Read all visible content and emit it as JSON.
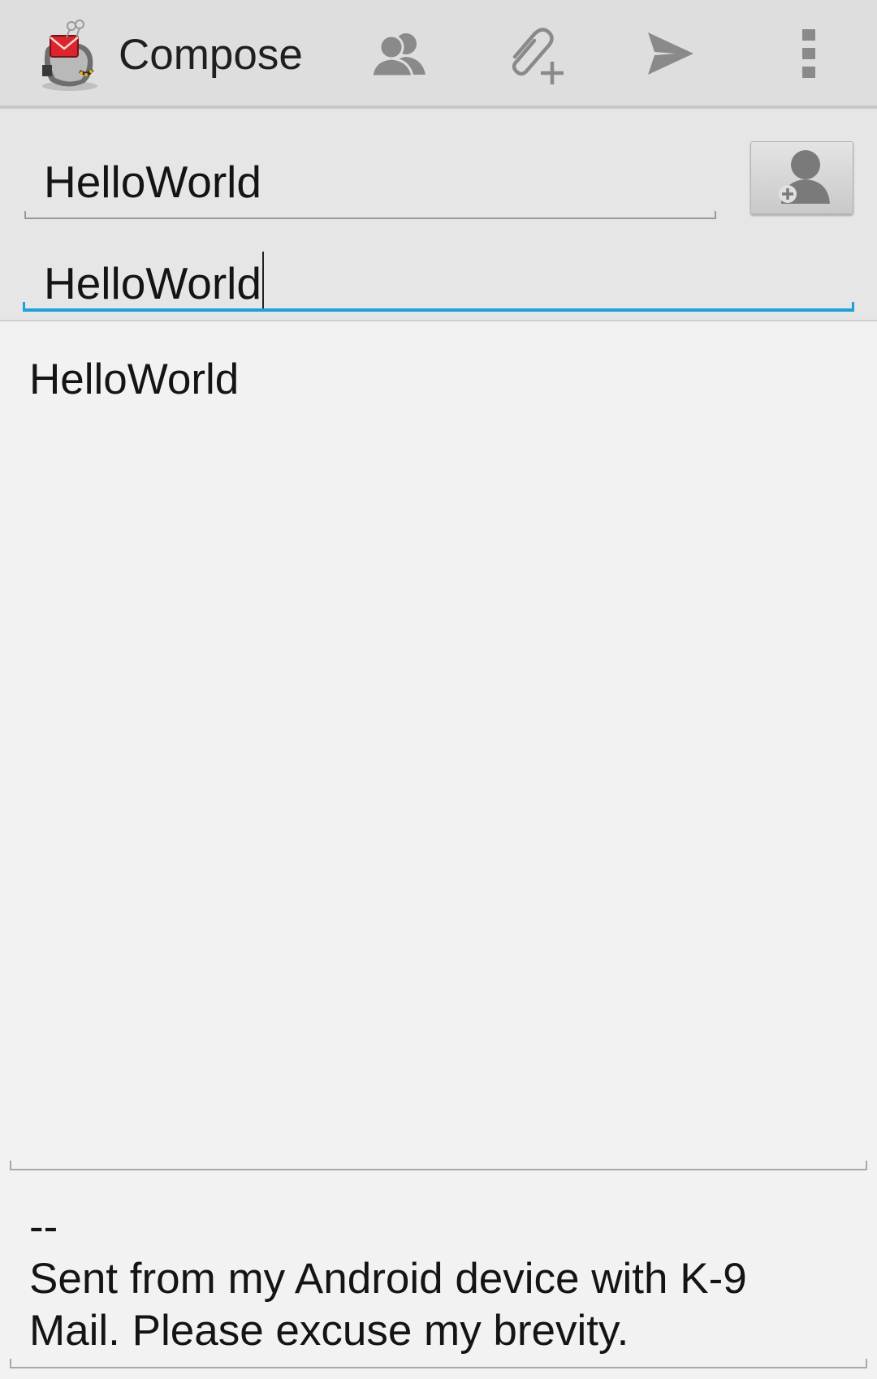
{
  "app": {
    "title": "Compose",
    "icon": "k9-mail-app-icon"
  },
  "action_bar": {
    "icons": [
      "contacts-icon",
      "attach-icon",
      "send-icon",
      "overflow-menu-icon"
    ]
  },
  "compose": {
    "to_value": "HelloWorld",
    "subject_value": "HelloWorld",
    "body_value": "HelloWorld",
    "signature_separator": "--",
    "signature_line1": "Sent from my Android device with K-9",
    "signature_line2": "Mail. Please excuse my brevity."
  },
  "colors": {
    "accent": "#1ea0d8",
    "action_bar_bg": "#dedede",
    "header_bg": "#e6e6e6",
    "body_bg": "#f2f2f2",
    "icon_gray": "#8a8a8a"
  }
}
